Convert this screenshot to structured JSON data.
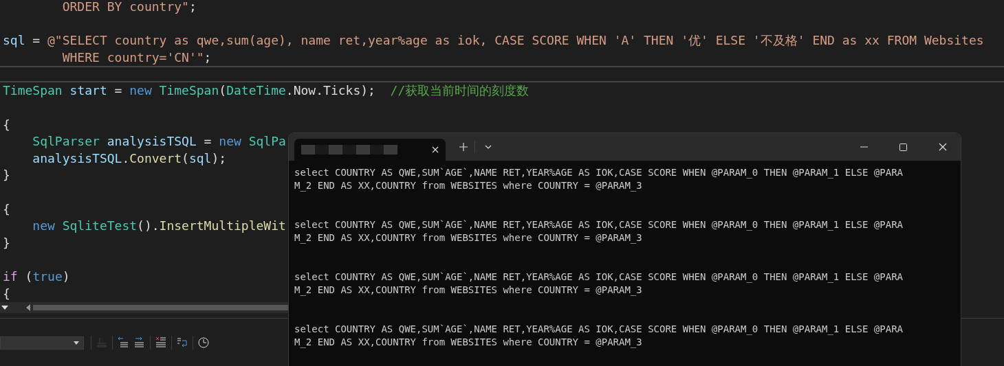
{
  "editor": {
    "top_lines": [
      {
        "kind": "code",
        "tokens": [
          {
            "kind": "string",
            "text": "        ORDER BY country\""
          },
          {
            "kind": "plain",
            "text": ";"
          }
        ]
      },
      {
        "kind": "blank"
      },
      {
        "kind": "code",
        "tokens": [
          {
            "kind": "variable",
            "text": "sql"
          },
          {
            "kind": "plain",
            "text": " = "
          },
          {
            "kind": "string",
            "text": "@\"SELECT country as qwe,sum(age), name ret,year%age as iok, CASE SCORE WHEN 'A' THEN '优' ELSE '不及格' END as xx FROM Websites"
          }
        ]
      },
      {
        "kind": "code",
        "tokens": [
          {
            "kind": "string",
            "text": "        WHERE country='CN'\""
          },
          {
            "kind": "plain",
            "text": ";"
          }
        ]
      }
    ],
    "lines": [
      {
        "kind": "code",
        "tokens": [
          {
            "kind": "type",
            "text": "TimeSpan"
          },
          {
            "kind": "variable",
            "text": " start"
          },
          {
            "kind": "plain",
            "text": " = "
          },
          {
            "kind": "keyword",
            "text": "new"
          },
          {
            "kind": "type",
            "text": " TimeSpan"
          },
          {
            "kind": "plain",
            "text": "("
          },
          {
            "kind": "type",
            "text": "DateTime"
          },
          {
            "kind": "plain",
            "text": ".Now.Ticks);  "
          },
          {
            "kind": "comment",
            "text": "//获取当前时间的刻度数"
          }
        ]
      },
      {
        "kind": "blank"
      },
      {
        "kind": "code",
        "tokens": [
          {
            "kind": "plain",
            "text": "{"
          }
        ]
      },
      {
        "kind": "code",
        "tokens": [
          {
            "kind": "type",
            "text": "    SqlParser"
          },
          {
            "kind": "variable",
            "text": " analysisTSQL"
          },
          {
            "kind": "plain",
            "text": " = "
          },
          {
            "kind": "keyword",
            "text": "new"
          },
          {
            "kind": "type",
            "text": " SqlPa"
          }
        ]
      },
      {
        "kind": "code",
        "tokens": [
          {
            "kind": "variable",
            "text": "    analysisTSQL"
          },
          {
            "kind": "plain",
            "text": "."
          },
          {
            "kind": "method",
            "text": "Convert"
          },
          {
            "kind": "plain",
            "text": "("
          },
          {
            "kind": "variable",
            "text": "sql"
          },
          {
            "kind": "plain",
            "text": ");"
          }
        ]
      },
      {
        "kind": "code",
        "tokens": [
          {
            "kind": "plain",
            "text": "}"
          }
        ]
      },
      {
        "kind": "blank"
      },
      {
        "kind": "code",
        "tokens": [
          {
            "kind": "plain",
            "text": "{"
          }
        ]
      },
      {
        "kind": "code",
        "tokens": [
          {
            "kind": "keyword",
            "text": "    new"
          },
          {
            "kind": "type",
            "text": " SqliteTest"
          },
          {
            "kind": "plain",
            "text": "()."
          },
          {
            "kind": "method",
            "text": "InsertMultipleWit"
          }
        ]
      },
      {
        "kind": "code",
        "tokens": [
          {
            "kind": "plain",
            "text": "}"
          }
        ]
      },
      {
        "kind": "blank"
      },
      {
        "kind": "code",
        "tokens": [
          {
            "kind": "control",
            "text": "if"
          },
          {
            "kind": "plain",
            "text": " ("
          },
          {
            "kind": "keyword",
            "text": "true"
          },
          {
            "kind": "plain",
            "text": ")"
          }
        ]
      },
      {
        "kind": "code",
        "tokens": [
          {
            "kind": "plain",
            "text": "{"
          }
        ]
      }
    ]
  },
  "terminal": {
    "output": [
      {
        "lines": [
          "select COUNTRY AS QWE,SUM`AGE`,NAME RET,YEAR%AGE AS IOK,CASE SCORE WHEN @PARAM_0 THEN @PARAM_1 ELSE @PARA",
          "M_2 END AS XX,COUNTRY from WEBSITES where COUNTRY = @PARAM_3"
        ]
      },
      {
        "lines": [
          "select COUNTRY AS QWE,SUM`AGE`,NAME RET,YEAR%AGE AS IOK,CASE SCORE WHEN @PARAM_0 THEN @PARAM_1 ELSE @PARA",
          "M_2 END AS XX,COUNTRY from WEBSITES where COUNTRY = @PARAM_3"
        ]
      },
      {
        "lines": [
          "select COUNTRY AS QWE,SUM`AGE`,NAME RET,YEAR%AGE AS IOK,CASE SCORE WHEN @PARAM_0 THEN @PARAM_1 ELSE @PARA",
          "M_2 END AS XX,COUNTRY from WEBSITES where COUNTRY = @PARAM_3"
        ]
      },
      {
        "lines": [
          "select COUNTRY AS QWE,SUM`AGE`,NAME RET,YEAR%AGE AS IOK,CASE SCORE WHEN @PARAM_0 THEN @PARAM_1 ELSE @PARA",
          "M_2 END AS XX,COUNTRY from WEBSITES where COUNTRY = @PARAM_3"
        ]
      }
    ]
  },
  "toolbar": {
    "items": [
      {
        "kind": "disabled"
      },
      {
        "kind": "outdent"
      },
      {
        "kind": "indent"
      },
      {
        "kind": "clear"
      },
      {
        "kind": "wrap"
      },
      {
        "kind": "clock"
      }
    ]
  }
}
